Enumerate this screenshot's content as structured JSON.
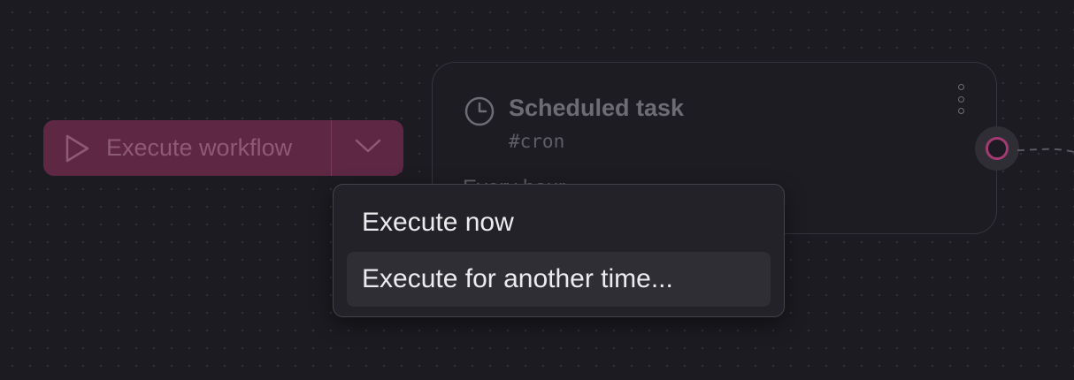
{
  "colors": {
    "canvas_bg": "#1c1b21",
    "accent": "#a33a72",
    "execute_button_bg": "#5e2845"
  },
  "toolbar": {
    "execute_label": "Execute workflow",
    "play_icon": "play-icon",
    "toggle_icon": "chevron-down-icon"
  },
  "node": {
    "icon": "clock-icon",
    "title": "Scheduled task",
    "tag": "#cron",
    "peek_text": "Every hour"
  },
  "menu": {
    "items": [
      {
        "label": "Execute now",
        "highlighted": false
      },
      {
        "label": "Execute for another time...",
        "highlighted": true
      }
    ]
  }
}
